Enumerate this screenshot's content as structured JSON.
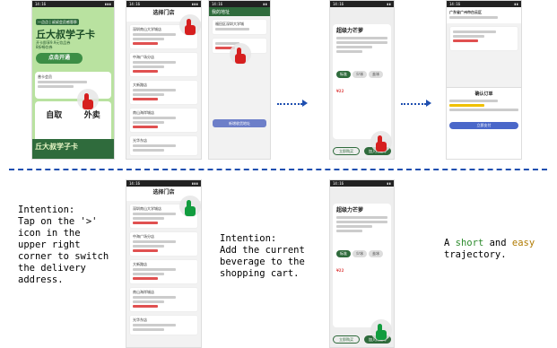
{
  "colors": {
    "accent": "#1f4fb0",
    "brand_green": "#2f6b3c",
    "tap_red": "#d61f1f",
    "tap_green": "#119c3e"
  },
  "status_bar": {
    "time": "14:16"
  },
  "screen1": {
    "banner_line": "一点点 | 叔叔会员感恩季",
    "headline": "丘大叔学子卡",
    "sub1": "开卡即享9.9元饮品券",
    "sub2": "8折畅饮券",
    "cta": "点击开通",
    "member": "普卡会员",
    "pickup": "自取",
    "delivery": "外卖",
    "bottom": "丘大叔学子卡"
  },
  "screen2": {
    "title": "选择门店",
    "store_labels": [
      "深圳南山大学城店",
      "中海广场分店",
      "大新路店",
      "南山海岸城店",
      "光华东店"
    ],
    "addr_hint": "广东省深圳市南山区"
  },
  "screen3": {
    "title": "我的地址",
    "addr": "福田区深圳大学城",
    "add_btn": "新增收货地址"
  },
  "screen4": {
    "product": "超级力芒萝",
    "price": "¥22",
    "sizes": [
      "标准",
      "少冰",
      "去冰",
      "热"
    ],
    "cart_btn": "加入购物车",
    "buy_btn": "立即购买"
  },
  "screen5": {
    "title": "确认订单",
    "store": "广东省广州市白云区",
    "pay": "立即支付"
  },
  "bottom_row": {
    "second_title": "选择门店",
    "fourth_product": "超级力芒萝",
    "fourth_price": "¥22"
  },
  "captions": {
    "intent_switch": [
      "Intention:",
      "Tap on the '>'",
      "icon in the",
      "upper right",
      "corner to switch",
      "the delivery",
      "address."
    ],
    "intent_cart": [
      "Intention:",
      "Add the current",
      "beverage to the",
      "shopping cart."
    ],
    "summary": {
      "pre": "A ",
      "short": "short",
      "mid": " and ",
      "easy": "easy",
      "post": "trajectory."
    }
  }
}
